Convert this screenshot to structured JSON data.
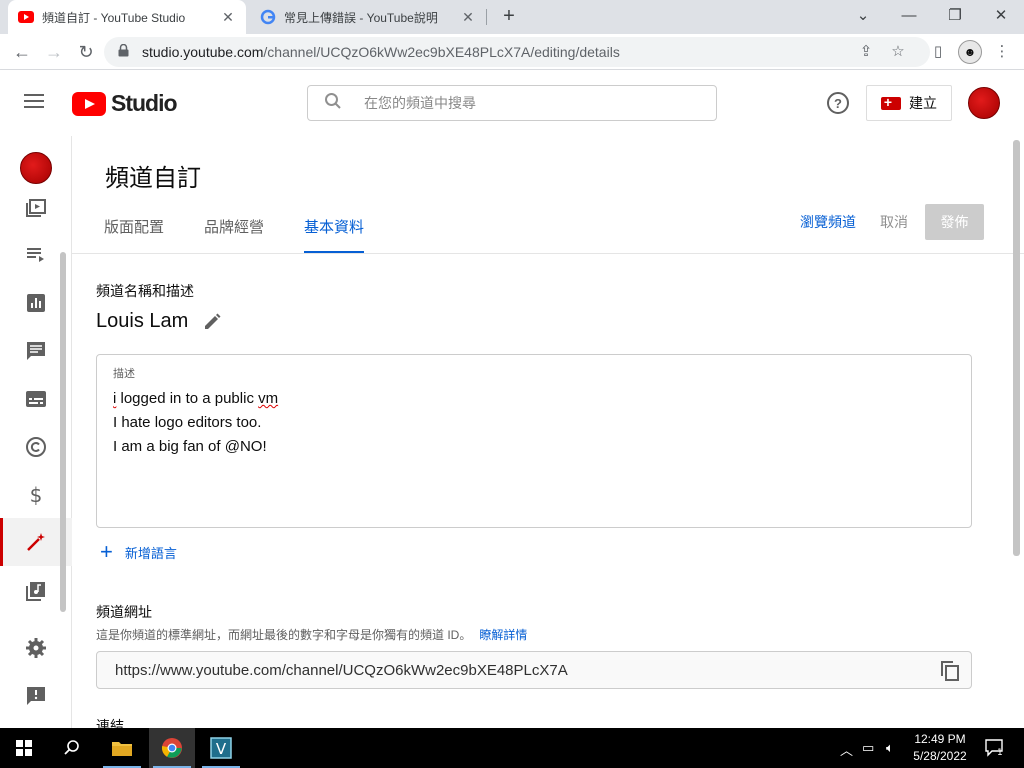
{
  "browser": {
    "tabs": [
      {
        "title": "頻道自訂 - YouTube Studio",
        "active": true
      },
      {
        "title": "常見上傳錯誤 - YouTube說明",
        "active": false
      }
    ],
    "url_host": "studio.youtube.com",
    "url_path": "/channel/UCQzO6kWw2ec9bXE48PLcX7A/editing/details"
  },
  "header": {
    "logo_text": "Studio",
    "search_placeholder": "在您的頻道中搜尋",
    "create_label": "建立"
  },
  "page": {
    "title": "頻道自訂",
    "tabs": [
      {
        "label": "版面配置",
        "selected": false
      },
      {
        "label": "品牌經營",
        "selected": false
      },
      {
        "label": "基本資料",
        "selected": true
      }
    ],
    "view_channel": "瀏覽頻道",
    "cancel": "取消",
    "publish": "發佈"
  },
  "basic_info": {
    "section_title": "頻道名稱和描述",
    "channel_name": "Louis Lam",
    "description_label": "描述",
    "description_lines": [
      "i logged in to a public vm",
      "I hate logo editors too.",
      "I am a big fan of @NO!"
    ],
    "add_language": "新增語言",
    "url_title": "頻道網址",
    "url_help": "這是你頻道的標準網址，而網址最後的數字和字母是你獨有的頻道 ID。",
    "learn_more": "瞭解詳情",
    "channel_url": "https://www.youtube.com/channel/UCQzO6kWw2ec9bXE48PLcX7A",
    "links_title": "連結"
  },
  "taskbar": {
    "time": "12:49 PM",
    "date": "5/28/2022"
  },
  "colors": {
    "accent": "#065fd4",
    "brand_red": "#ff0000",
    "active_marker": "#cc0000"
  }
}
